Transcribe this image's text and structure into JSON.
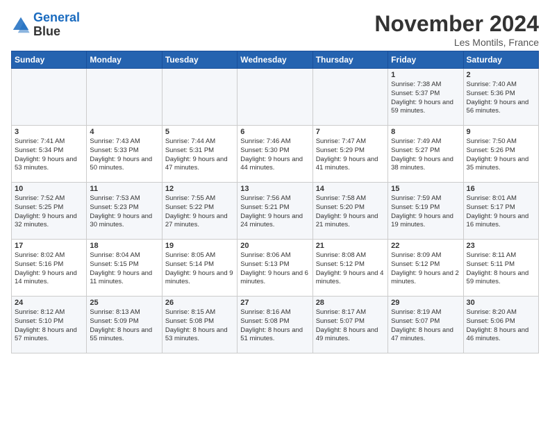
{
  "header": {
    "logo_line1": "General",
    "logo_line2": "Blue",
    "title": "November 2024",
    "location": "Les Montils, France"
  },
  "days_of_week": [
    "Sunday",
    "Monday",
    "Tuesday",
    "Wednesday",
    "Thursday",
    "Friday",
    "Saturday"
  ],
  "weeks": [
    [
      {
        "day": "",
        "info": ""
      },
      {
        "day": "",
        "info": ""
      },
      {
        "day": "",
        "info": ""
      },
      {
        "day": "",
        "info": ""
      },
      {
        "day": "",
        "info": ""
      },
      {
        "day": "1",
        "info": "Sunrise: 7:38 AM\nSunset: 5:37 PM\nDaylight: 9 hours and 59 minutes."
      },
      {
        "day": "2",
        "info": "Sunrise: 7:40 AM\nSunset: 5:36 PM\nDaylight: 9 hours and 56 minutes."
      }
    ],
    [
      {
        "day": "3",
        "info": "Sunrise: 7:41 AM\nSunset: 5:34 PM\nDaylight: 9 hours and 53 minutes."
      },
      {
        "day": "4",
        "info": "Sunrise: 7:43 AM\nSunset: 5:33 PM\nDaylight: 9 hours and 50 minutes."
      },
      {
        "day": "5",
        "info": "Sunrise: 7:44 AM\nSunset: 5:31 PM\nDaylight: 9 hours and 47 minutes."
      },
      {
        "day": "6",
        "info": "Sunrise: 7:46 AM\nSunset: 5:30 PM\nDaylight: 9 hours and 44 minutes."
      },
      {
        "day": "7",
        "info": "Sunrise: 7:47 AM\nSunset: 5:29 PM\nDaylight: 9 hours and 41 minutes."
      },
      {
        "day": "8",
        "info": "Sunrise: 7:49 AM\nSunset: 5:27 PM\nDaylight: 9 hours and 38 minutes."
      },
      {
        "day": "9",
        "info": "Sunrise: 7:50 AM\nSunset: 5:26 PM\nDaylight: 9 hours and 35 minutes."
      }
    ],
    [
      {
        "day": "10",
        "info": "Sunrise: 7:52 AM\nSunset: 5:25 PM\nDaylight: 9 hours and 32 minutes."
      },
      {
        "day": "11",
        "info": "Sunrise: 7:53 AM\nSunset: 5:23 PM\nDaylight: 9 hours and 30 minutes."
      },
      {
        "day": "12",
        "info": "Sunrise: 7:55 AM\nSunset: 5:22 PM\nDaylight: 9 hours and 27 minutes."
      },
      {
        "day": "13",
        "info": "Sunrise: 7:56 AM\nSunset: 5:21 PM\nDaylight: 9 hours and 24 minutes."
      },
      {
        "day": "14",
        "info": "Sunrise: 7:58 AM\nSunset: 5:20 PM\nDaylight: 9 hours and 21 minutes."
      },
      {
        "day": "15",
        "info": "Sunrise: 7:59 AM\nSunset: 5:19 PM\nDaylight: 9 hours and 19 minutes."
      },
      {
        "day": "16",
        "info": "Sunrise: 8:01 AM\nSunset: 5:17 PM\nDaylight: 9 hours and 16 minutes."
      }
    ],
    [
      {
        "day": "17",
        "info": "Sunrise: 8:02 AM\nSunset: 5:16 PM\nDaylight: 9 hours and 14 minutes."
      },
      {
        "day": "18",
        "info": "Sunrise: 8:04 AM\nSunset: 5:15 PM\nDaylight: 9 hours and 11 minutes."
      },
      {
        "day": "19",
        "info": "Sunrise: 8:05 AM\nSunset: 5:14 PM\nDaylight: 9 hours and 9 minutes."
      },
      {
        "day": "20",
        "info": "Sunrise: 8:06 AM\nSunset: 5:13 PM\nDaylight: 9 hours and 6 minutes."
      },
      {
        "day": "21",
        "info": "Sunrise: 8:08 AM\nSunset: 5:12 PM\nDaylight: 9 hours and 4 minutes."
      },
      {
        "day": "22",
        "info": "Sunrise: 8:09 AM\nSunset: 5:12 PM\nDaylight: 9 hours and 2 minutes."
      },
      {
        "day": "23",
        "info": "Sunrise: 8:11 AM\nSunset: 5:11 PM\nDaylight: 8 hours and 59 minutes."
      }
    ],
    [
      {
        "day": "24",
        "info": "Sunrise: 8:12 AM\nSunset: 5:10 PM\nDaylight: 8 hours and 57 minutes."
      },
      {
        "day": "25",
        "info": "Sunrise: 8:13 AM\nSunset: 5:09 PM\nDaylight: 8 hours and 55 minutes."
      },
      {
        "day": "26",
        "info": "Sunrise: 8:15 AM\nSunset: 5:08 PM\nDaylight: 8 hours and 53 minutes."
      },
      {
        "day": "27",
        "info": "Sunrise: 8:16 AM\nSunset: 5:08 PM\nDaylight: 8 hours and 51 minutes."
      },
      {
        "day": "28",
        "info": "Sunrise: 8:17 AM\nSunset: 5:07 PM\nDaylight: 8 hours and 49 minutes."
      },
      {
        "day": "29",
        "info": "Sunrise: 8:19 AM\nSunset: 5:07 PM\nDaylight: 8 hours and 47 minutes."
      },
      {
        "day": "30",
        "info": "Sunrise: 8:20 AM\nSunset: 5:06 PM\nDaylight: 8 hours and 46 minutes."
      }
    ]
  ]
}
